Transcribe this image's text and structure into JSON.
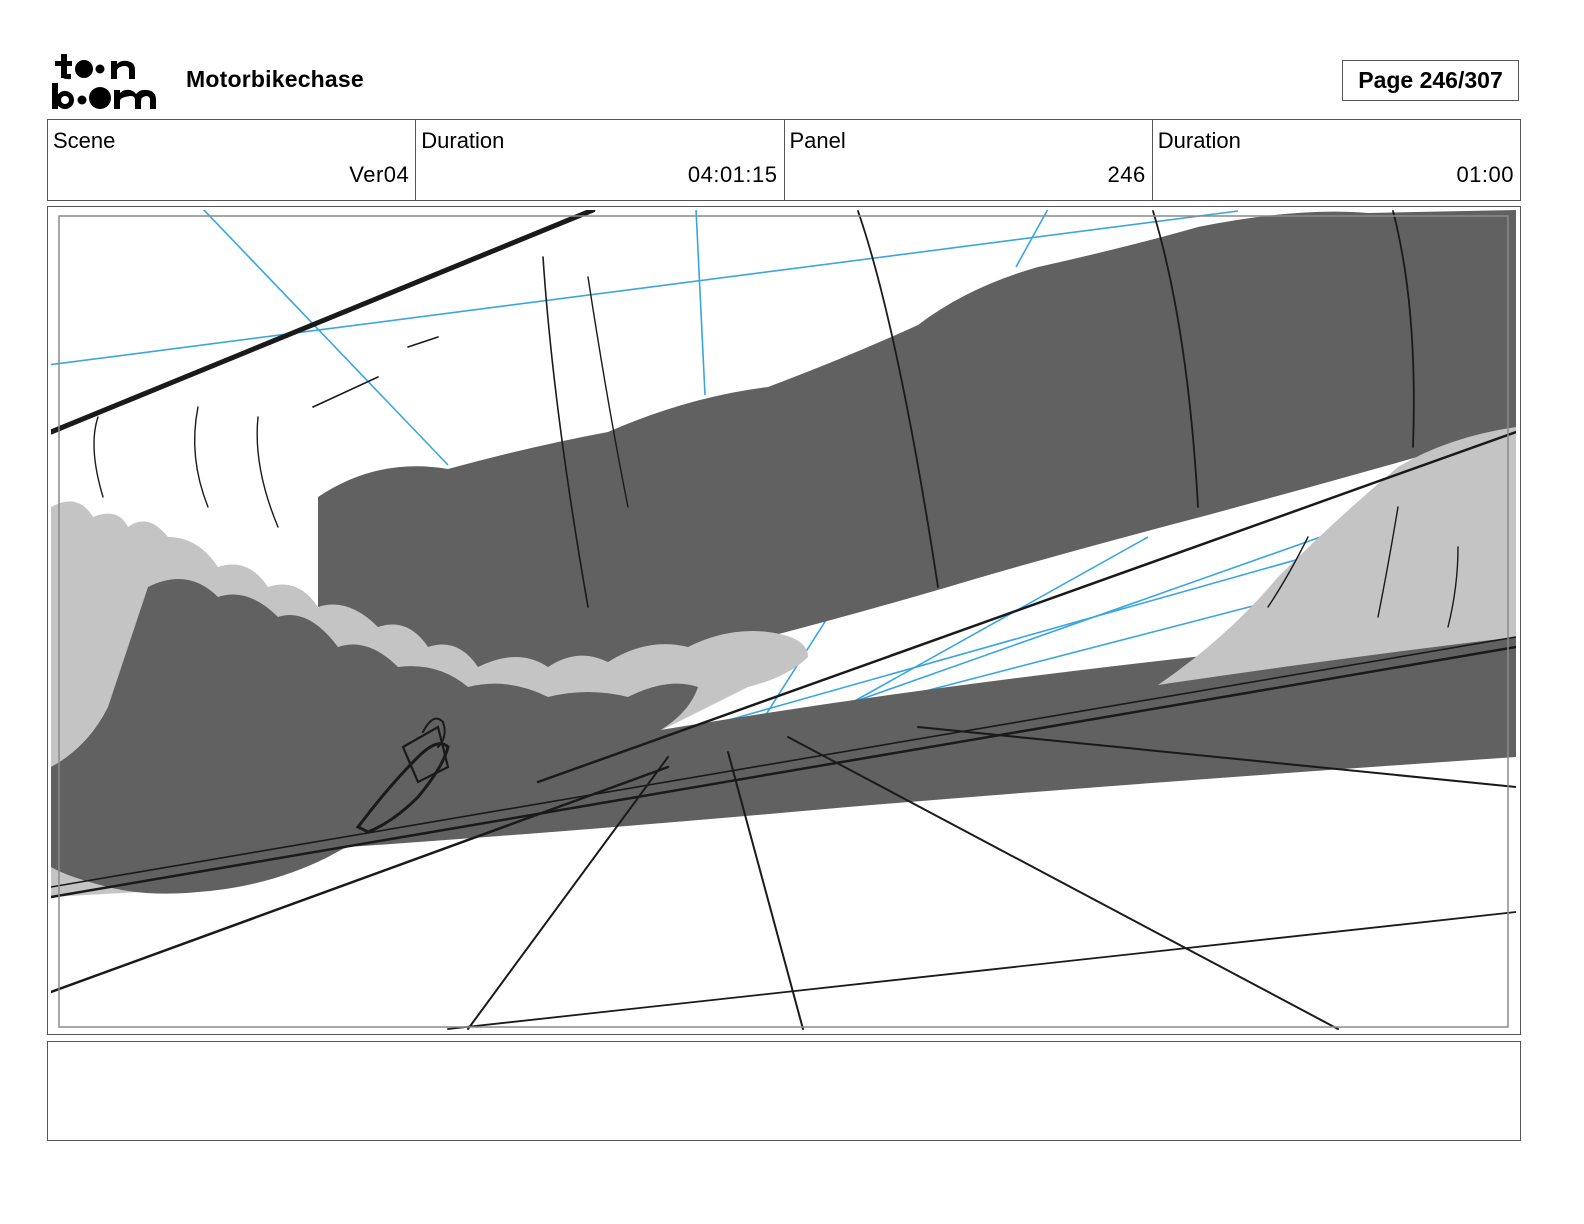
{
  "header": {
    "project_title": "Motorbikechase",
    "page_indicator": "Page 246/307"
  },
  "info": {
    "scene_label": "Scene",
    "scene_value": "Ver04",
    "scene_duration_label": "Duration",
    "scene_duration_value": "04:01:15",
    "panel_label": "Panel",
    "panel_value": "246",
    "panel_duration_label": "Duration",
    "panel_duration_value": "01:00"
  },
  "colors": {
    "guide_blue": "#3aa6e0",
    "dark_fill": "#616161",
    "light_fill": "#c4c4c4",
    "ink": "#1a1a1a"
  },
  "notes": {
    "text": ""
  }
}
